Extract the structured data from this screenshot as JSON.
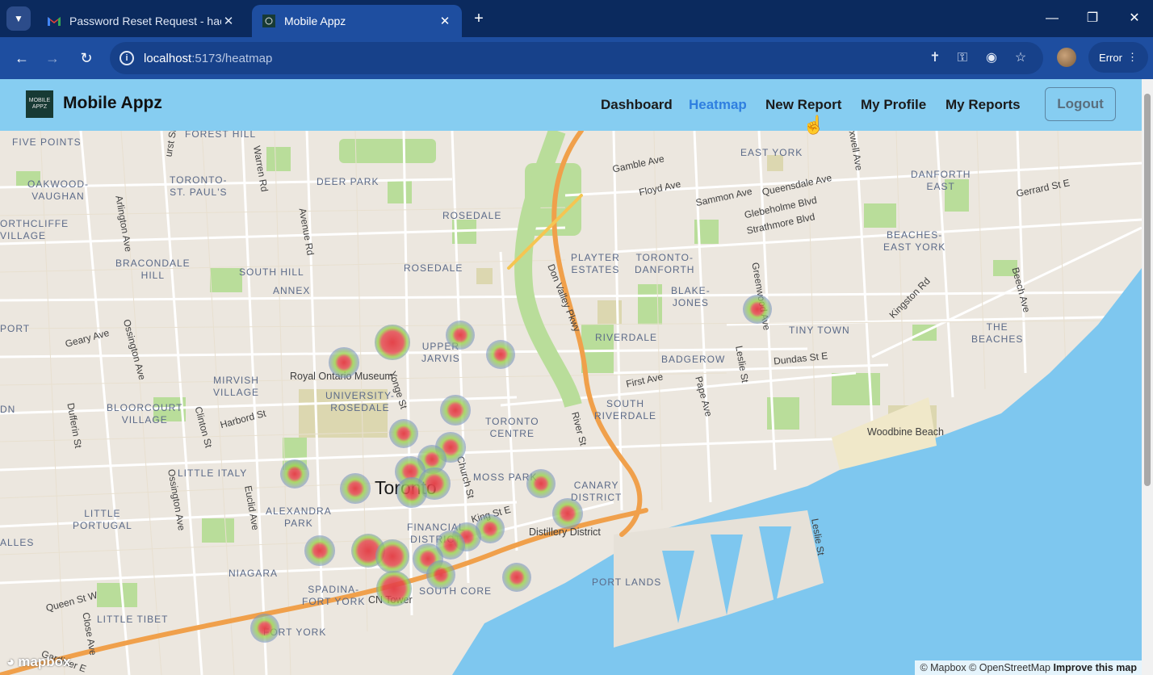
{
  "browser": {
    "tabs": [
      {
        "title": "Password Reset Request - hacto",
        "favicon": "gmail-icon",
        "active": false
      },
      {
        "title": "Mobile Appz",
        "favicon": "site-icon",
        "active": true
      }
    ],
    "url_host": "localhost",
    "url_path": ":5173/heatmap",
    "error_label": "Error"
  },
  "app": {
    "brand": "Mobile Appz",
    "logo_text": "MOBILE APPZ",
    "nav": [
      {
        "label": "Dashboard",
        "active": false
      },
      {
        "label": "Heatmap",
        "active": true
      },
      {
        "label": "New Report",
        "active": false
      },
      {
        "label": "My Profile",
        "active": false
      },
      {
        "label": "My Reports",
        "active": false
      }
    ],
    "logout_label": "Logout"
  },
  "map": {
    "city_label": "Toronto",
    "neighbourhoods": [
      "FOREST HILL",
      "FIVE POINTS",
      "OAKWOOD-\nVAUGHAN",
      "TORONTO-\nST. PAUL'S",
      "DEER PARK",
      "ROSEDALE",
      "EAST YORK",
      "DANFORTH\nEAST",
      "ORTHCLIFFE\nVILLAGE",
      "BRACONDALE\nHILL",
      "SOUTH HILL",
      "ROSEDALE",
      "PLAYTER\nESTATES",
      "TORONTO-\nDANFORTH",
      "BEACHES-\nEAST YORK",
      "ANNEX",
      "BLAKE-\nJONES",
      "PORT",
      "UPPER\nJARVIS",
      "RIVERDALE",
      "TINY TOWN",
      "THE\nBEACHES",
      "BADGEROW",
      "MIRVISH\nVILLAGE",
      "UNIVERSITY-\nROSEDALE",
      "BLOORCOURT\nVILLAGE",
      "TORONTO\nCENTRE",
      "SOUTH\nRIVERDALE",
      "LITTLE ITALY",
      "MOSS PARK",
      "CANARY\nDISTRICT",
      "LITTLE\nPORTUGAL",
      "ALEXANDRA\nPARK",
      "FINANCIAL\nDISTRICT",
      "ALLES",
      "NIAGARA",
      "SPADINA-\nFORT YORK",
      "SOUTH CORE",
      "PORT LANDS",
      "LITTLE TIBET",
      "FORT YORK",
      "DN"
    ],
    "streets": [
      "urst St",
      "Warren Rd",
      "Avenue Rd",
      "Arlington Ave",
      "Gamble Ave",
      "Floyd Ave",
      "Sammon Ave",
      "Queensdale Ave",
      "Glebeholme Blvd",
      "Strathmore Blvd",
      "Gerrard St E",
      "Coxwell Ave",
      "Greenwood Ave",
      "Kingston Rd",
      "Beech Ave",
      "Don Valley Pkwy",
      "Geary Ave",
      "Ossington Ave",
      "Yonge St",
      "Harbord St",
      "Clinton St",
      "Dufferin St",
      "Dundas St E",
      "Leslie St",
      "First Ave",
      "Pape Ave",
      "River St",
      "Church St",
      "King St E",
      "Euclid Ave",
      "Ossington Ave",
      "Queen St W",
      "Close Ave",
      "Leslie St",
      "Gardiner E"
    ],
    "pois": [
      "Royal Ontario Museum",
      "Woodbine Beach",
      "Distillery District",
      "CN Tower"
    ],
    "attribution": "© Mapbox © OpenStreetMap",
    "improve_link": "Improve this map",
    "logo": "mapbox",
    "heat_points": [
      {
        "intensity": 0.95
      },
      {
        "intensity": 0.6
      },
      {
        "intensity": 0.55
      },
      {
        "intensity": 0.5
      },
      {
        "intensity": 0.55
      },
      {
        "intensity": 0.6
      },
      {
        "intensity": 0.55
      },
      {
        "intensity": 0.6
      },
      {
        "intensity": 0.55
      },
      {
        "intensity": 0.6
      },
      {
        "intensity": 0.55
      },
      {
        "intensity": 0.6
      },
      {
        "intensity": 0.7
      },
      {
        "intensity": 0.55
      },
      {
        "intensity": 0.6
      },
      {
        "intensity": 0.55
      },
      {
        "intensity": 0.55
      },
      {
        "intensity": 0.6
      },
      {
        "intensity": 0.9
      },
      {
        "intensity": 0.85
      },
      {
        "intensity": 0.55
      },
      {
        "intensity": 0.6
      },
      {
        "intensity": 0.55
      },
      {
        "intensity": 0.95
      },
      {
        "intensity": 0.55
      },
      {
        "intensity": 0.55
      },
      {
        "intensity": 0.6
      }
    ],
    "colors": {
      "water": "#7ec7ef",
      "land": "#ece7df",
      "park": "#b9dd9a",
      "highway": "#f0a04b",
      "heat_hot": "#e4434a",
      "heat_mid": "#9ad54a",
      "heat_cool": "#6d7ce8"
    }
  }
}
